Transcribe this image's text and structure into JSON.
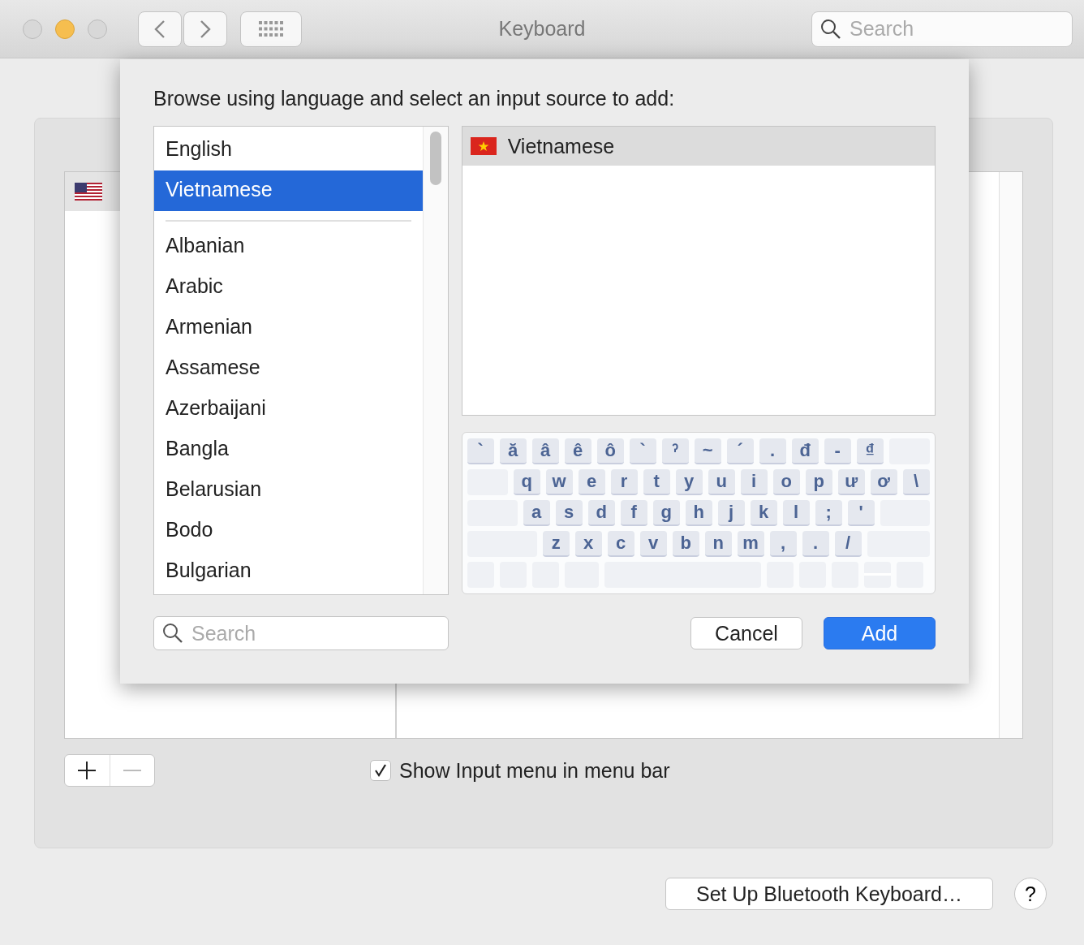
{
  "window": {
    "title": "Keyboard",
    "search_placeholder": "Search"
  },
  "background": {
    "show_input_menu": {
      "label": "Show Input menu in menu bar",
      "checked": true
    },
    "bluetooth_button": "Set Up Bluetooth Keyboard…",
    "help_button": "?"
  },
  "sheet": {
    "prompt": "Browse using language and select an input source to add:",
    "language_groups": [
      [
        {
          "label": "English",
          "selected": false
        },
        {
          "label": "Vietnamese",
          "selected": true
        }
      ],
      [
        {
          "label": "Albanian",
          "selected": false
        },
        {
          "label": "Arabic",
          "selected": false
        },
        {
          "label": "Armenian",
          "selected": false
        },
        {
          "label": "Assamese",
          "selected": false
        },
        {
          "label": "Azerbaijani",
          "selected": false
        },
        {
          "label": "Bangla",
          "selected": false
        },
        {
          "label": "Belarusian",
          "selected": false
        },
        {
          "label": "Bodo",
          "selected": false
        },
        {
          "label": "Bulgarian",
          "selected": false
        }
      ]
    ],
    "input_sources": [
      {
        "label": "Vietnamese",
        "selected": true
      }
    ],
    "keyboard_rows": [
      [
        "`",
        "ă",
        "â",
        "ê",
        "ô",
        "`",
        "ˀ",
        "~",
        "´",
        ".",
        "đ",
        "-",
        "₫"
      ],
      [
        "q",
        "w",
        "e",
        "r",
        "t",
        "y",
        "u",
        "i",
        "o",
        "p",
        "ư",
        "ơ",
        "\\"
      ],
      [
        "a",
        "s",
        "d",
        "f",
        "g",
        "h",
        "j",
        "k",
        "l",
        ";",
        "'"
      ],
      [
        "z",
        "x",
        "c",
        "v",
        "b",
        "n",
        "m",
        ",",
        ".",
        "/"
      ]
    ],
    "search_placeholder": "Search",
    "cancel_button": "Cancel",
    "add_button": "Add"
  }
}
